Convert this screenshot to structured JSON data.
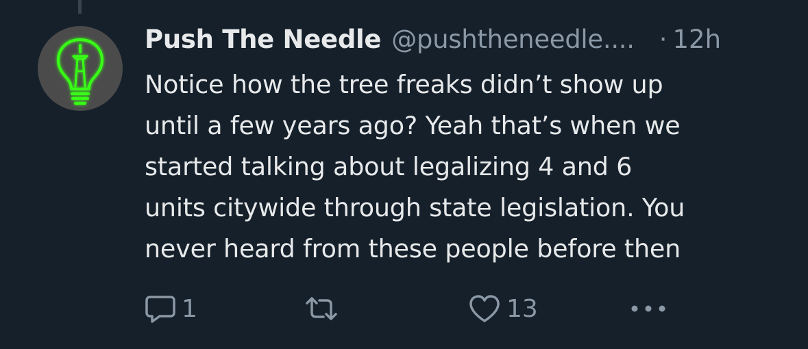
{
  "tweet": {
    "display_name": "Push The Needle",
    "handle": "@pushtheneedle....",
    "separator": "·",
    "timestamp": "12h",
    "text_lines": [
      "Notice how the tree freaks didn’t show up",
      "until a few years ago? Yeah that’s when we",
      "started talking about legalizing 4 and 6",
      "units citywide through state legislation. You",
      "never heard from these people before then"
    ],
    "actions": {
      "reply_count": "1",
      "retweet_count": "",
      "like_count": "13"
    }
  },
  "icons": {
    "avatar": "lightbulb-space-needle-icon",
    "reply": "reply-icon",
    "retweet": "retweet-icon",
    "like": "heart-icon",
    "more": "more-icon"
  },
  "colors": {
    "background": "#15202b",
    "primary_text": "#e7e9ea",
    "secondary_text": "#8b98a5",
    "avatar_glow": "#39ff14"
  }
}
